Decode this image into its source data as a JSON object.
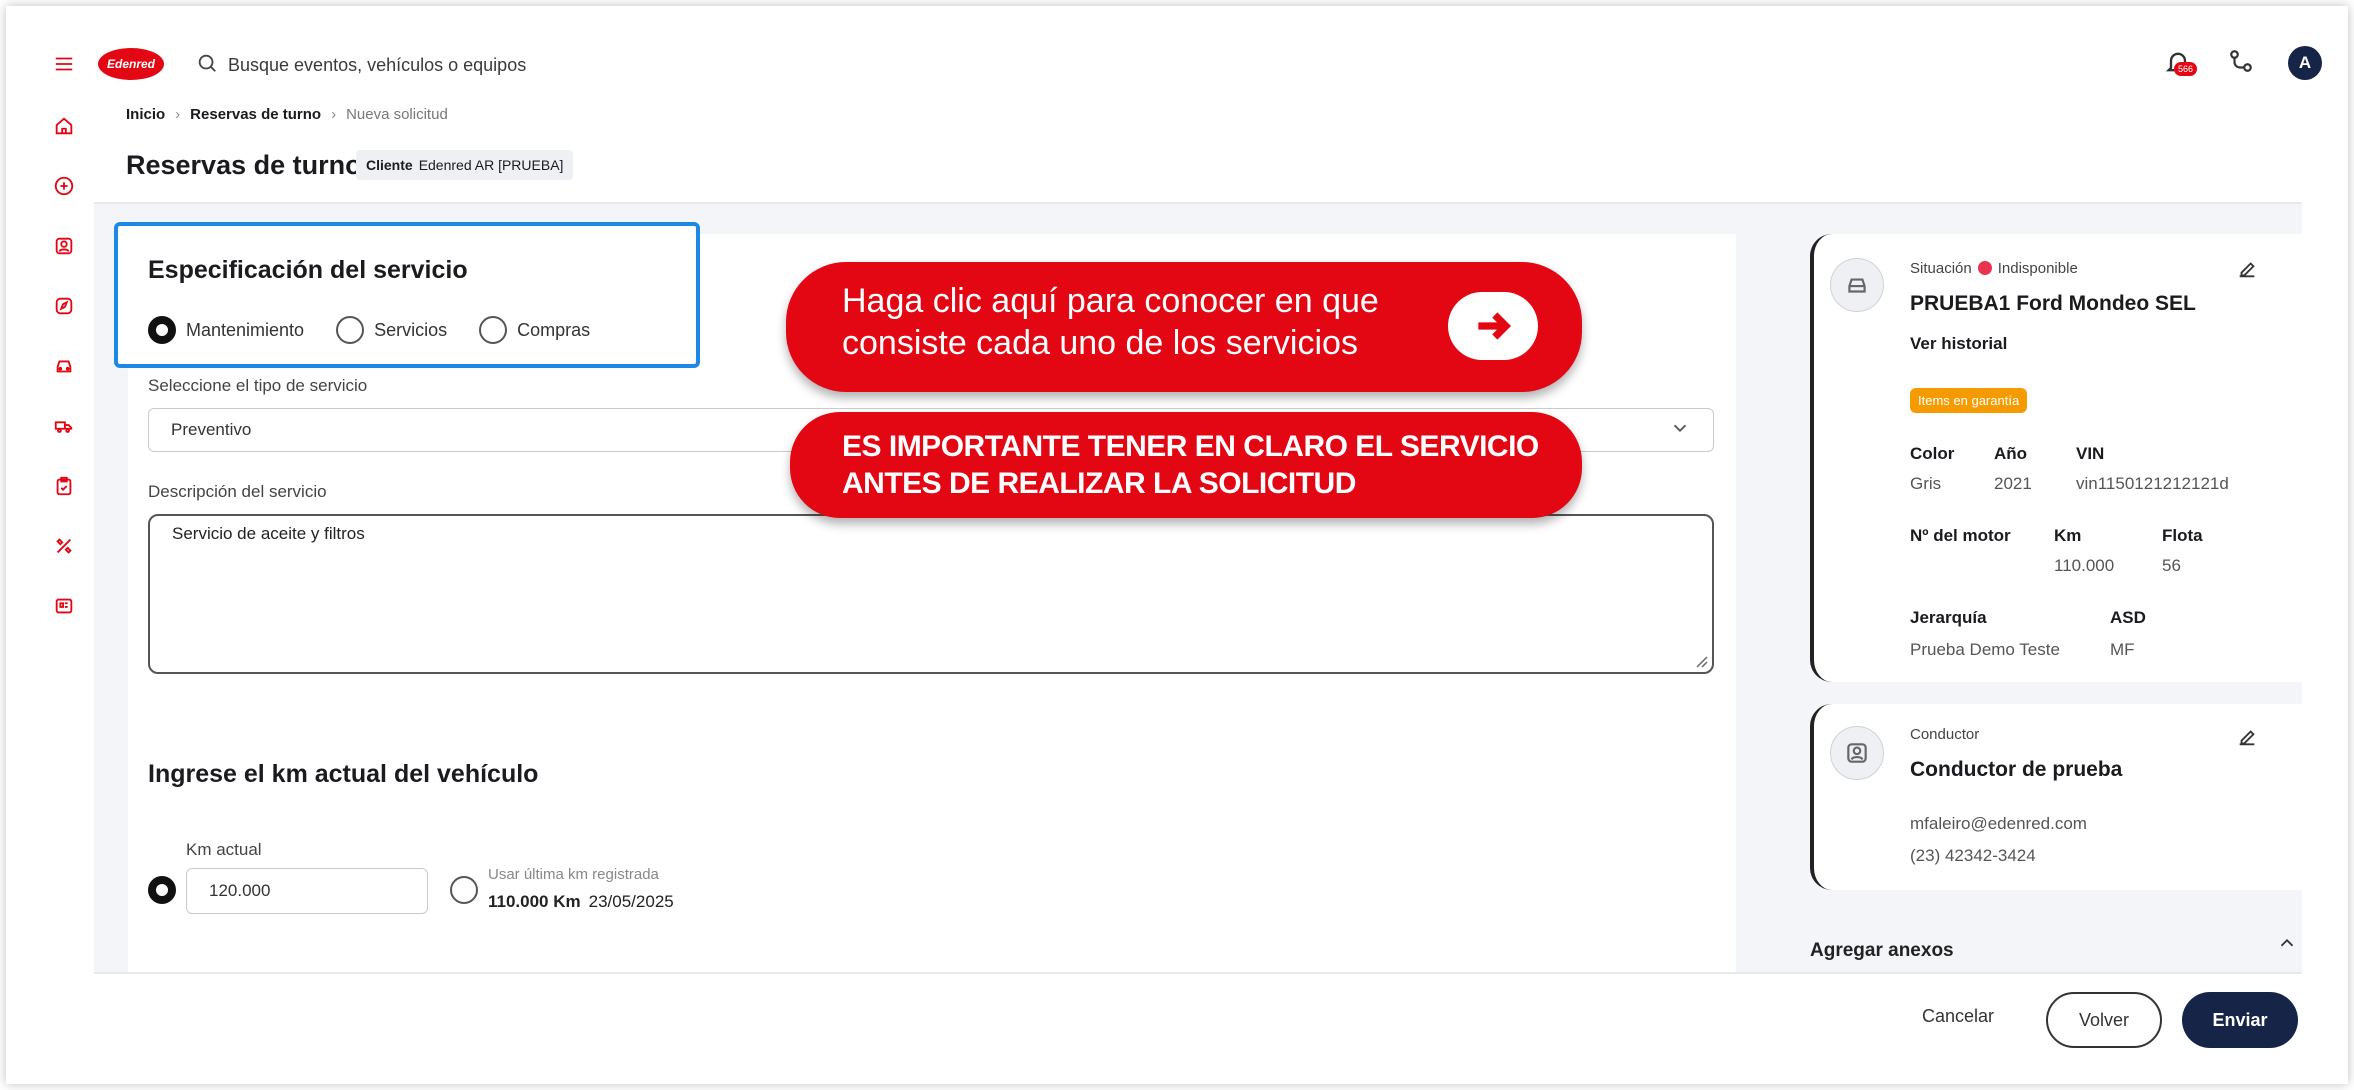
{
  "app": {
    "logo_text": "Edenred",
    "brand_color": "#e30613",
    "search_placeholder": "Busque eventos, vehículos o equipos",
    "notifications_count": "566",
    "avatar_initial": "A"
  },
  "breadcrumb": {
    "home": "Inicio",
    "section": "Reservas de turno",
    "current": "Nueva solicitud"
  },
  "header": {
    "title": "Reservas de turno",
    "client_label": "Cliente",
    "client_value": "Edenred AR [PRUEBA]"
  },
  "spec": {
    "title": "Especificación del servicio",
    "options": [
      "Mantenimiento",
      "Servicios",
      "Compras"
    ],
    "selected": "Mantenimiento",
    "type_label": "Seleccione el tipo de servicio",
    "type_value": "Preventivo",
    "desc_label": "Descripción del servicio",
    "desc_value": "Servicio de aceite y filtros"
  },
  "callouts": {
    "info_line1": "Haga clic aquí para conocer en que",
    "info_line2": "consiste cada uno de los servicios",
    "warn_line1": "ES IMPORTANTE TENER EN CLARO EL SERVICIO",
    "warn_line2": "ANTES DE REALIZAR LA SOLICITUD"
  },
  "km": {
    "title": "Ingrese el km actual del vehículo",
    "current_label": "Km actual",
    "current_value": "120.000",
    "last_label": "Usar última km registrada",
    "last_value": "110.000 Km",
    "last_date": "23/05/2025"
  },
  "vehicle": {
    "status_label": "Situación",
    "status_value": "Indisponible",
    "name": "PRUEBA1  Ford Mondeo SEL",
    "history_link": "Ver historial",
    "warranty_badge": "Items en garantía",
    "color_label": "Color",
    "color_value": "Gris",
    "year_label": "Año",
    "year_value": "2021",
    "vin_label": "VIN",
    "vin_value": "vin1150121212121d",
    "engine_label": "Nº del motor",
    "km_label": "Km",
    "km_value": "110.000",
    "fleet_label": "Flota",
    "fleet_value": "56",
    "hier_label": "Jerarquía",
    "hier_value": "Prueba Demo Teste",
    "asd_label": "ASD",
    "asd_value": "MF"
  },
  "driver": {
    "label": "Conductor",
    "name": "Conductor de prueba",
    "email": "mfaleiro@edenred.com",
    "phone": "(23) 42342-3424"
  },
  "attachments": {
    "title": "Agregar anexos"
  },
  "footer": {
    "cancel": "Cancelar",
    "back": "Volver",
    "send": "Enviar"
  }
}
